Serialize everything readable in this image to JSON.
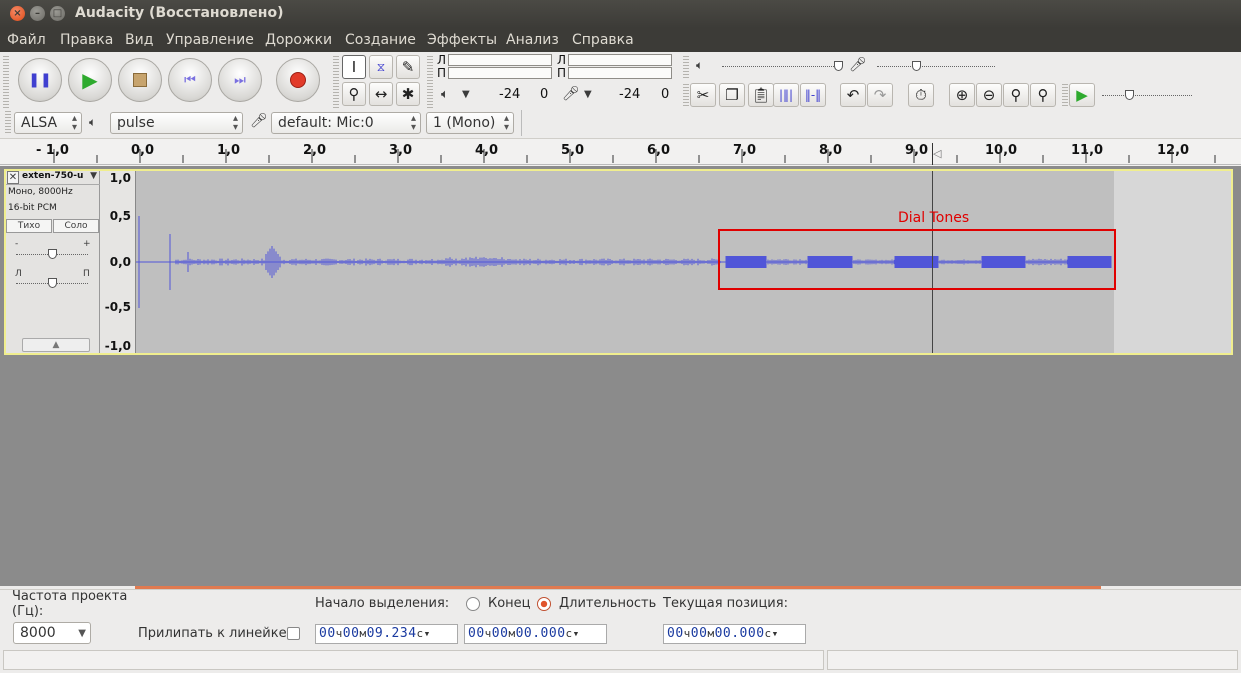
{
  "window": {
    "title": "Audacity (Восстановлено)"
  },
  "menu": [
    "Файл",
    "Правка",
    "Вид",
    "Управление",
    "Дорожки",
    "Создание",
    "Эффекты",
    "Анализ",
    "Справка"
  ],
  "meters": {
    "left_label": "Л",
    "right_label": "П",
    "play_db": "-24",
    "play_zero": "0",
    "rec_db": "-24",
    "rec_zero": "0"
  },
  "device": {
    "host": "ALSA",
    "output": "pulse",
    "input": "default: Mic:0",
    "channels": "1 (Mono)"
  },
  "ruler": [
    "- 1,0",
    "0,0",
    "1,0",
    "2,0",
    "3,0",
    "4,0",
    "5,0",
    "6,0",
    "7,0",
    "8,0",
    "9,0",
    "10,0",
    "11,0",
    "12,0"
  ],
  "track": {
    "name": "exten-750-u",
    "info1": "Моно, 8000Hz",
    "info2": "16-bit PCM",
    "mute": "Тихо",
    "solo": "Соло",
    "gain_minus": "-",
    "gain_plus": "+",
    "pan_left": "Л",
    "pan_right": "П",
    "scale": [
      "1,0",
      "0,5",
      "0,0",
      "-0,5",
      "-1,0"
    ]
  },
  "annotation": {
    "label": "Dial Tones",
    "color": "#e00000"
  },
  "bottom": {
    "rate_label": "Частота проекта (Гц):",
    "rate_value": "8000",
    "snap_label": "Прилипать к линейке",
    "sel_start_label": "Начало выделения:",
    "end_label": "Конец",
    "length_label": "Длительность",
    "position_label": "Текущая позиция:",
    "sel_start": {
      "h": "00",
      "m": "00",
      "s": "09.234"
    },
    "sel_length": {
      "h": "00",
      "m": "00",
      "s": "00.000"
    },
    "position": {
      "h": "00",
      "m": "00",
      "s": "00.000"
    },
    "unit_h": "ч",
    "unit_m": "м",
    "unit_s": "с"
  },
  "colors": {
    "waveform": "#5055d8",
    "track_border": "#f0ee8e",
    "titlebar": "#3c3b37"
  }
}
